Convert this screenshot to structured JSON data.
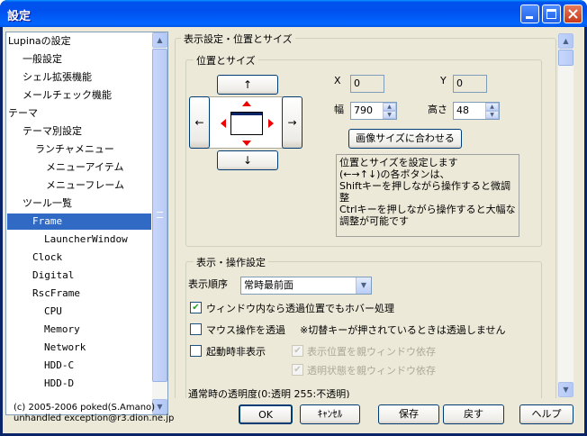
{
  "window": {
    "title": "設定"
  },
  "tree": {
    "items": [
      {
        "label": "Lupinaの設定"
      },
      {
        "label": "一般設定"
      },
      {
        "label": "シェル拡張機能"
      },
      {
        "label": "メールチェック機能"
      },
      {
        "label": "テーマ"
      },
      {
        "label": "テーマ別設定"
      },
      {
        "label": "ランチャメニュー"
      },
      {
        "label": "メニューアイテム"
      },
      {
        "label": "メニューフレーム"
      },
      {
        "label": "ツール一覧"
      },
      {
        "label": "Frame"
      },
      {
        "label": "LauncherWindow"
      },
      {
        "label": "Clock"
      },
      {
        "label": "Digital"
      },
      {
        "label": "RscFrame"
      },
      {
        "label": "CPU"
      },
      {
        "label": "Memory"
      },
      {
        "label": "Network"
      },
      {
        "label": "HDD-C"
      },
      {
        "label": "HDD-D"
      }
    ],
    "selected": "Frame"
  },
  "footer": {
    "copyright": "(c) 2005-2006 poked(S.Amano)",
    "contact": "unhandled exception@r3.dion.ne.jp"
  },
  "buttons": {
    "ok": "OK",
    "cancel": "ｷｬﾝｾﾙ",
    "save": "保存",
    "revert": "戻す",
    "help": "ヘルプ"
  },
  "panel": {
    "title": "表示設定・位置とサイズ",
    "position_group": {
      "title": "位置とサイズ",
      "arrow_up": "↑",
      "arrow_down": "↓",
      "arrow_left": "←",
      "arrow_right": "→",
      "x_label": "X",
      "x_value": "0",
      "y_label": "Y",
      "y_value": "0",
      "width_label": "幅",
      "width_value": "790",
      "height_label": "高さ",
      "height_value": "48",
      "fit_image_button": "画像サイズに合わせる",
      "description": "位置とサイズを設定します\n(←→↑↓)の各ボタンは、\nShiftキーを押しながら操作すると微調整\nCtrlキーを押しながら操作すると大幅な調整が可能です"
    },
    "display_group": {
      "title": "表示・操作設定",
      "order_label": "表示順序",
      "order_value": "常時最前面",
      "hover_in_transparent": "ウィンドウ内なら透過位置でもホバー処理",
      "mouse_transparent": "マウス操作を透過",
      "mouse_transparent_note": "※切替キーが押されているときは透過しません",
      "hide_on_start": "起動時非表示",
      "pos_depends_parent": "表示位置を親ウィンドウ依存",
      "alpha_depends_parent": "透明状態を親ウィンドウ依存",
      "opacity_label_partial": "通常時の透明度(0:透明 255:不透明)"
    }
  },
  "colors": {
    "selection": "#316ac5",
    "titlebar": "#0054e3",
    "face": "#ece9d8",
    "marker": "#e00000"
  }
}
